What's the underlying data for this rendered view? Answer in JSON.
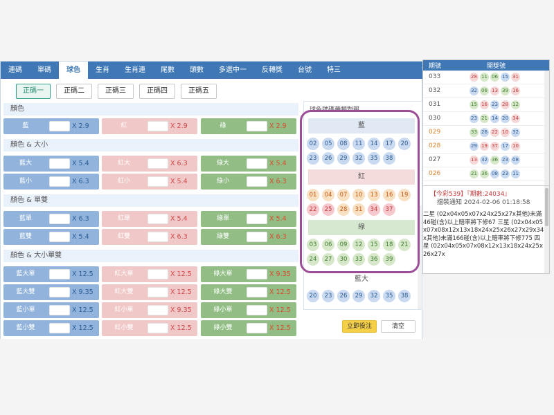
{
  "tabs": [
    "連碼",
    "單碼",
    "球色",
    "生肖",
    "生肖連",
    "尾數",
    "頭數",
    "多選中一",
    "反轉獎",
    "台號",
    "特三"
  ],
  "active_tab": "球色",
  "subtabs": [
    "正碼一",
    "正碼二",
    "正碼三",
    "正碼四",
    "正碼五"
  ],
  "sections": {
    "color": "顏色",
    "color_size": "顏色 & 大小",
    "color_odd_even": "顏色 & 單雙",
    "color_size_odd_even": "顏色 & 大小單雙"
  },
  "bets": {
    "color": [
      {
        "label": "藍",
        "odds": "X 2.9"
      },
      {
        "label": "紅",
        "odds": "X 2.9"
      },
      {
        "label": "綠",
        "odds": "X 2.9"
      }
    ],
    "color_size_r1": [
      {
        "label": "藍大",
        "odds": "X 5.4"
      },
      {
        "label": "紅大",
        "odds": "X 6.3"
      },
      {
        "label": "綠大",
        "odds": "X 5.4"
      }
    ],
    "color_size_r2": [
      {
        "label": "藍小",
        "odds": "X 6.3"
      },
      {
        "label": "紅小",
        "odds": "X 5.4"
      },
      {
        "label": "綠小",
        "odds": "X 6.3"
      }
    ],
    "odd_even_r1": [
      {
        "label": "藍單",
        "odds": "X 6.3"
      },
      {
        "label": "紅單",
        "odds": "X 5.4"
      },
      {
        "label": "綠單",
        "odds": "X 5.4"
      }
    ],
    "odd_even_r2": [
      {
        "label": "藍雙",
        "odds": "X 5.4"
      },
      {
        "label": "紅雙",
        "odds": "X 6.3"
      },
      {
        "label": "綠雙",
        "odds": "X 6.3"
      }
    ],
    "sos_r1": [
      {
        "label": "藍大單",
        "odds": "X 12.5"
      },
      {
        "label": "紅大單",
        "odds": "X 12.5"
      },
      {
        "label": "綠大單",
        "odds": "X 9.35"
      }
    ],
    "sos_r2": [
      {
        "label": "藍大雙",
        "odds": "X 9.35"
      },
      {
        "label": "紅大雙",
        "odds": "X 12.5"
      },
      {
        "label": "綠大雙",
        "odds": "X 12.5"
      }
    ],
    "sos_r3": [
      {
        "label": "藍小單",
        "odds": "X 12.5"
      },
      {
        "label": "紅小單",
        "odds": "X 9.35"
      },
      {
        "label": "綠小單",
        "odds": "X 12.5"
      }
    ],
    "sos_r4": [
      {
        "label": "藍小雙",
        "odds": "X 12.5"
      },
      {
        "label": "紅小雙",
        "odds": "X 12.5"
      },
      {
        "label": "綠小雙",
        "odds": "X 12.5"
      }
    ]
  },
  "ball_panel": {
    "title": "球色號碼種類對照",
    "blue_label": "藍",
    "blue": [
      "02",
      "05",
      "08",
      "11",
      "14",
      "17",
      "20",
      "23",
      "26",
      "29",
      "32",
      "35",
      "38"
    ],
    "red_label": "紅",
    "red": [
      "01",
      "04",
      "07",
      "10",
      "13",
      "16",
      "19",
      "22",
      "25",
      "28",
      "31",
      "34",
      "37"
    ],
    "green_label": "綠",
    "green": [
      "03",
      "06",
      "09",
      "12",
      "15",
      "18",
      "21",
      "24",
      "27",
      "30",
      "33",
      "36",
      "39"
    ],
    "blue_big_label": "藍大",
    "blue_big": [
      "20",
      "23",
      "26",
      "29",
      "32",
      "35",
      "38"
    ]
  },
  "buttons": {
    "bet": "立即投注",
    "clear": "清空"
  },
  "results": {
    "col_period": "期號",
    "col_numbers": "開獎號",
    "rows": [
      {
        "no": "033",
        "balls": [
          [
            "28",
            "r"
          ],
          [
            "11",
            "g"
          ],
          [
            "06",
            "g"
          ],
          [
            "15",
            "b"
          ],
          [
            "31",
            "r"
          ]
        ]
      },
      {
        "no": "032",
        "balls": [
          [
            "32",
            "b"
          ],
          [
            "06",
            "g"
          ],
          [
            "13",
            "r"
          ],
          [
            "39",
            "g"
          ],
          [
            "16",
            "r"
          ]
        ]
      },
      {
        "no": "031",
        "balls": [
          [
            "15",
            "g"
          ],
          [
            "16",
            "r"
          ],
          [
            "23",
            "b"
          ],
          [
            "28",
            "r"
          ],
          [
            "12",
            "g"
          ]
        ]
      },
      {
        "no": "030",
        "balls": [
          [
            "23",
            "b"
          ],
          [
            "21",
            "g"
          ],
          [
            "14",
            "b"
          ],
          [
            "20",
            "b"
          ],
          [
            "34",
            "r"
          ]
        ]
      },
      {
        "no": "029",
        "balls": [
          [
            "33",
            "g"
          ],
          [
            "26",
            "b"
          ],
          [
            "22",
            "r"
          ],
          [
            "10",
            "r"
          ],
          [
            "32",
            "b"
          ]
        ]
      },
      {
        "no": "028",
        "balls": [
          [
            "29",
            "b"
          ],
          [
            "19",
            "r"
          ],
          [
            "37",
            "r"
          ],
          [
            "17",
            "b"
          ],
          [
            "10",
            "r"
          ]
        ]
      },
      {
        "no": "027",
        "balls": [
          [
            "13",
            "r"
          ],
          [
            "32",
            "b"
          ],
          [
            "36",
            "g"
          ],
          [
            "23",
            "b"
          ],
          [
            "08",
            "b"
          ]
        ]
      },
      {
        "no": "026",
        "balls": [
          [
            "21",
            "g"
          ],
          [
            "36",
            "g"
          ],
          [
            "08",
            "b"
          ],
          [
            "23",
            "b"
          ],
          [
            "11",
            "b"
          ]
        ]
      }
    ]
  },
  "notice": {
    "title": "【今彩539】『期數:24034』",
    "subtitle": "擋裝通知 2024-02-06 01:18:58",
    "body": "二星 (02x04x05x07x24x25x27x其他)未滿46碰(含)以上賠率將下修67 三星 (02x04x05x07x08x12x13x18x24x25x26x27x29x34x其他)未滿166碰(含)以上賠率將下修775 四星 (02x04x05x07x08x12x13x18x24x25x26x27x"
  }
}
